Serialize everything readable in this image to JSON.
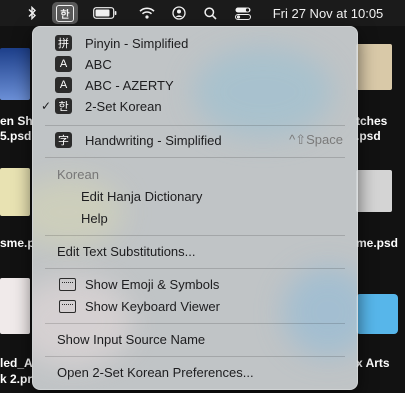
{
  "menubar": {
    "input_glyph": "한",
    "datetime": "Fri 27 Nov at  10:05"
  },
  "desktop": {
    "labels": [
      "en Sh",
      "5.psd",
      "sme.psd",
      "led_A",
      "k 2.pr",
      "tches",
      ".psd",
      "me.psd",
      "x Arts"
    ]
  },
  "menu": {
    "input_sources": [
      {
        "icon": "拼",
        "label": "Pinyin - Simplified",
        "checked": false
      },
      {
        "icon": "A",
        "label": "ABC",
        "checked": false
      },
      {
        "icon": "A",
        "label": "ABC - AZERTY",
        "checked": false
      },
      {
        "icon": "한",
        "label": "2-Set Korean",
        "checked": true
      }
    ],
    "checkmark": "✓",
    "handwriting": {
      "icon": "字",
      "label": "Handwriting - Simplified",
      "shortcut": "^⇧Space"
    },
    "korean_section": {
      "header": "Korean",
      "items": [
        "Edit Hanja Dictionary",
        "Help"
      ]
    },
    "edit_text_substitutions": "Edit Text Substitutions...",
    "show_emoji": "Show Emoji & Symbols",
    "show_keyboard_viewer": "Show Keyboard Viewer",
    "show_input_source_name": "Show Input Source Name",
    "open_preferences": "Open 2-Set Korean Preferences..."
  }
}
